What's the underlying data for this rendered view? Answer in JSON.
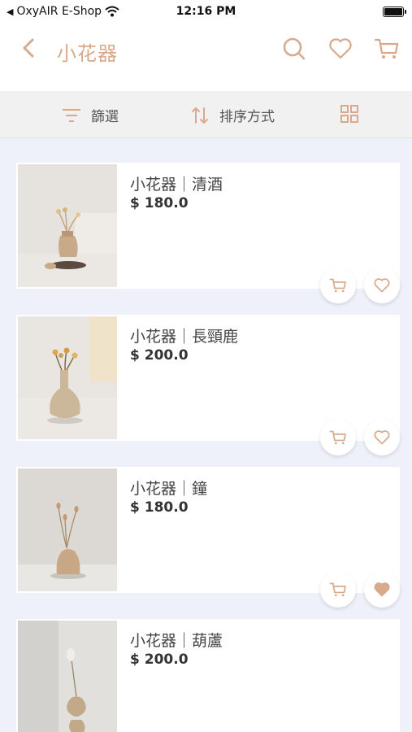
{
  "status": {
    "back_app": "OxyAIR E-Shop",
    "time": "12:16 PM"
  },
  "nav": {
    "title": "小花器"
  },
  "filter": {
    "filter_label": "篩選",
    "sort_label": "排序方式"
  },
  "products": [
    {
      "name": "小花器｜清酒",
      "price": "$ 180.0",
      "favorited": false
    },
    {
      "name": "小花器｜長頸鹿",
      "price": "$ 200.0",
      "favorited": false
    },
    {
      "name": "小花器｜鐘",
      "price": "$ 180.0",
      "favorited": true
    },
    {
      "name": "小花器｜葫蘆",
      "price": "$ 200.0",
      "favorited": false
    }
  ],
  "colors": {
    "accent": "#d9a98b",
    "background": "#eef0fa",
    "heart_filled": "#d9a98b"
  },
  "icons": [
    "back-icon",
    "search-icon",
    "heart-icon",
    "cart-icon",
    "filter-icon",
    "sort-icon",
    "grid-icon",
    "wifi-icon",
    "battery-icon"
  ]
}
